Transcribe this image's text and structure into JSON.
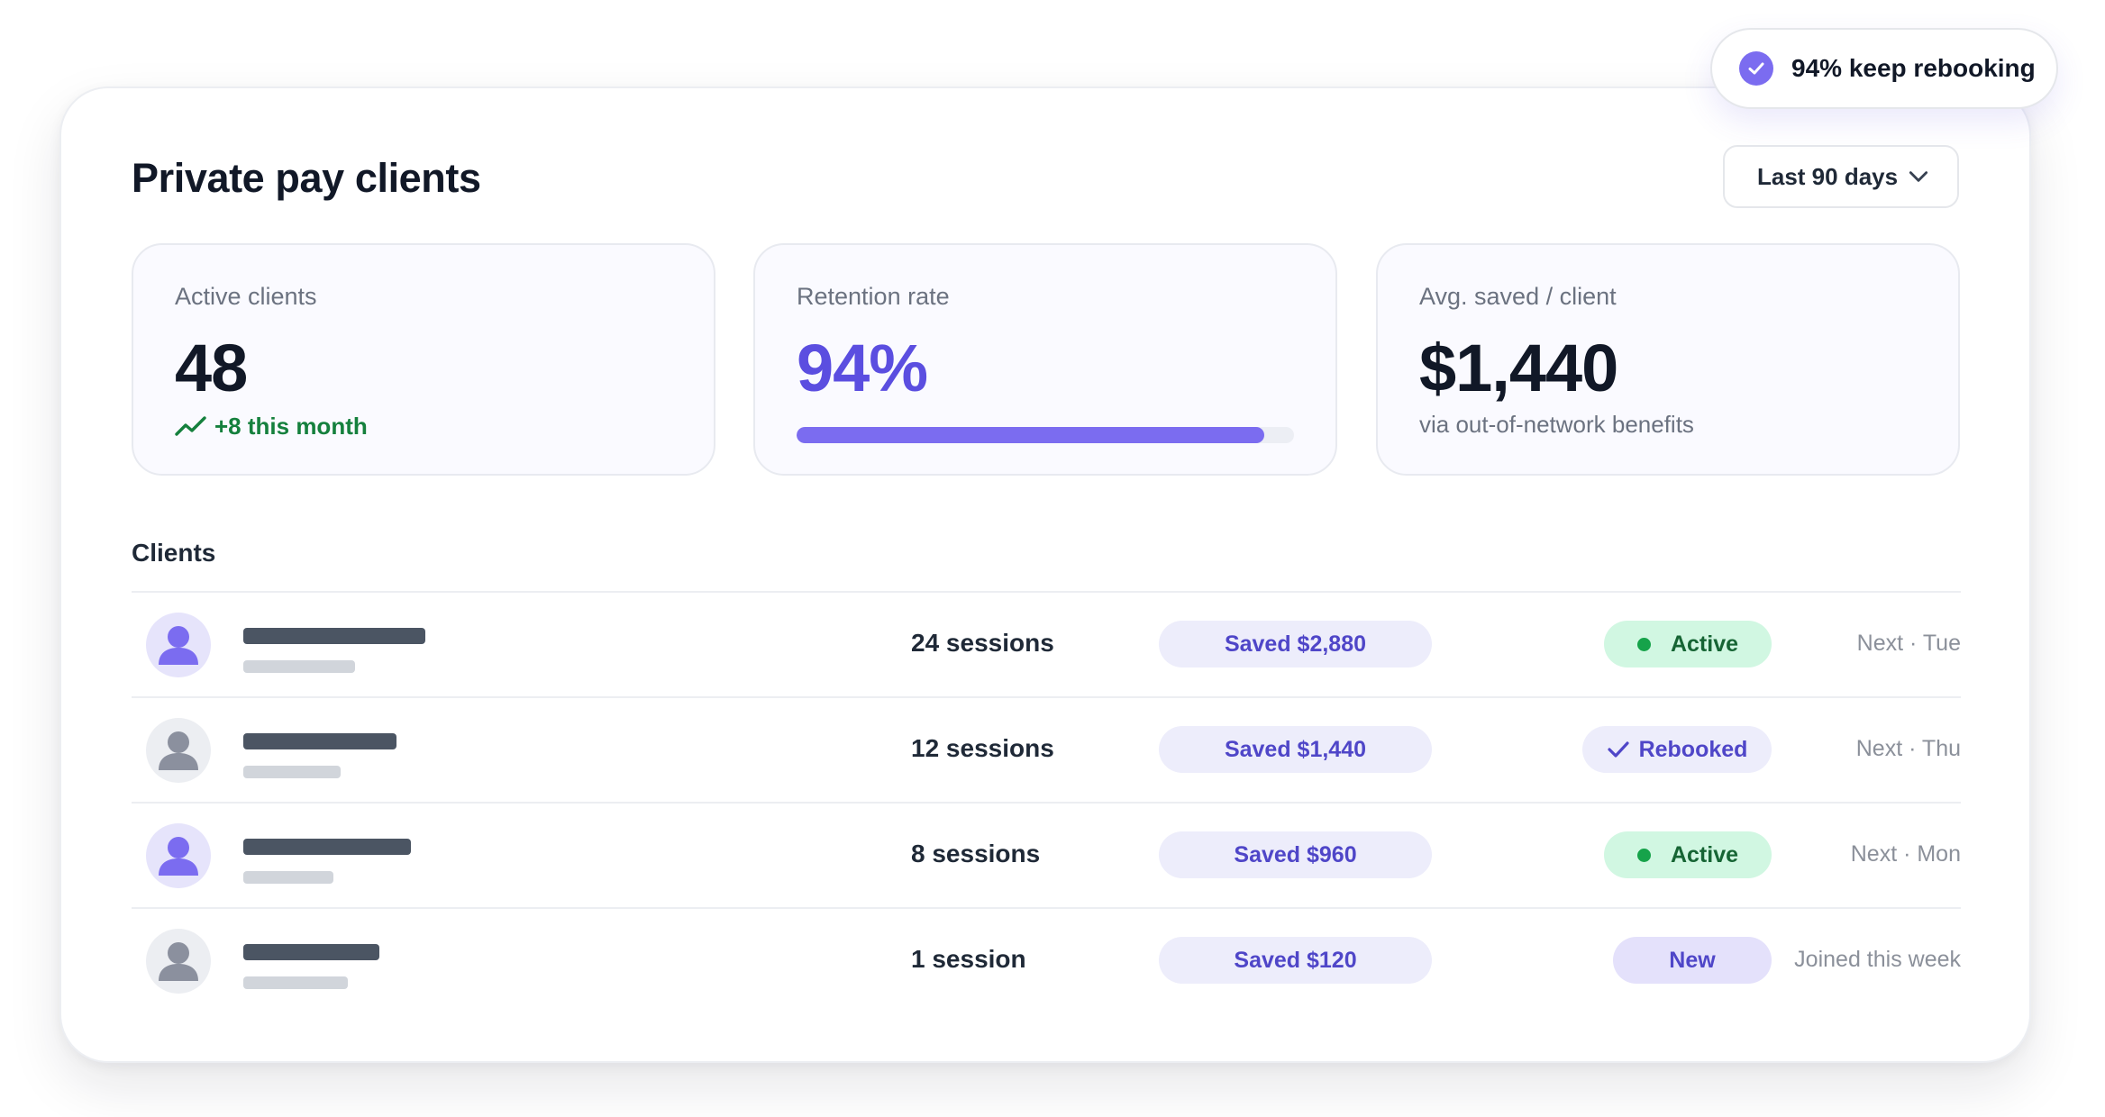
{
  "header": {
    "title": "Private pay clients",
    "period_select": {
      "value": "Last 90 days"
    }
  },
  "badge": {
    "text": "94% keep rebooking"
  },
  "stats": {
    "active_clients": {
      "label": "Active clients",
      "value": "48",
      "trend": "+8 this month"
    },
    "retention": {
      "label": "Retention rate",
      "value": "94%",
      "progress_percent": 94
    },
    "avg_saved": {
      "label": "Avg. saved / client",
      "value": "$1,440",
      "sub": "via out-of-network benefits"
    }
  },
  "clients": {
    "title": "Clients",
    "rows": [
      {
        "sessions": "24 sessions",
        "saved": "Saved $2,880",
        "status": "Active",
        "next": "Next · Tue"
      },
      {
        "sessions": "12 sessions",
        "saved": "Saved $1,440",
        "status": "Rebooked",
        "next": "Next · Thu"
      },
      {
        "sessions": "8 sessions",
        "saved": "Saved $960",
        "status": "Active",
        "next": "Next · Mon"
      },
      {
        "sessions": "1 session",
        "saved": "Saved $120",
        "status": "New",
        "next": "Joined this week"
      }
    ]
  },
  "colors": {
    "accent": "#5b4ee0",
    "progress": "#7b6cf0",
    "positive": "#15803d",
    "active_bg": "#d1f7e2",
    "pill_bg": "#ededfb"
  }
}
